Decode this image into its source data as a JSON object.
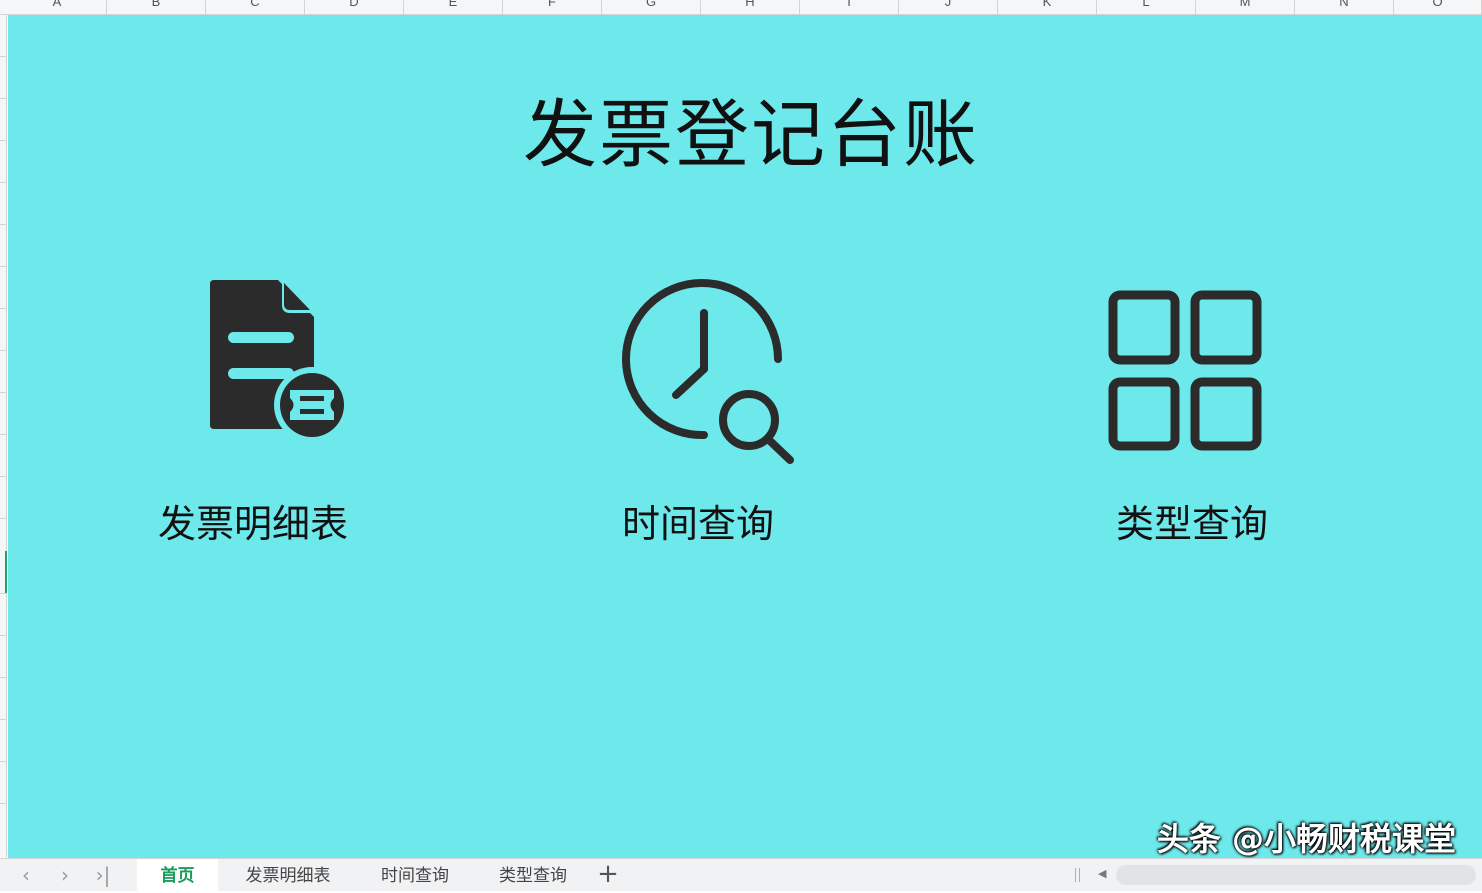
{
  "spreadsheet": {
    "columns": [
      "A",
      "B",
      "C",
      "D",
      "E",
      "F",
      "G",
      "H",
      "I",
      "J",
      "K",
      "L",
      "M",
      "N",
      "O"
    ]
  },
  "dashboard": {
    "title": "发票登记台账",
    "background_color": "#6de8eb",
    "icon_color": "#2b2b2b",
    "items": [
      {
        "label": "发票明细表",
        "icon": "invoice-document-icon"
      },
      {
        "label": "时间查询",
        "icon": "clock-search-icon"
      },
      {
        "label": "类型查询",
        "icon": "grid-four-squares-icon"
      }
    ]
  },
  "sheet_tabs": {
    "tabs": [
      {
        "label": "首页",
        "active": true
      },
      {
        "label": "发票明细表",
        "active": false
      },
      {
        "label": "时间查询",
        "active": false
      },
      {
        "label": "类型查询",
        "active": false
      }
    ],
    "add_label": "+",
    "active_color": "#1a9c5c"
  },
  "watermark": "头条 @小畅财税课堂"
}
